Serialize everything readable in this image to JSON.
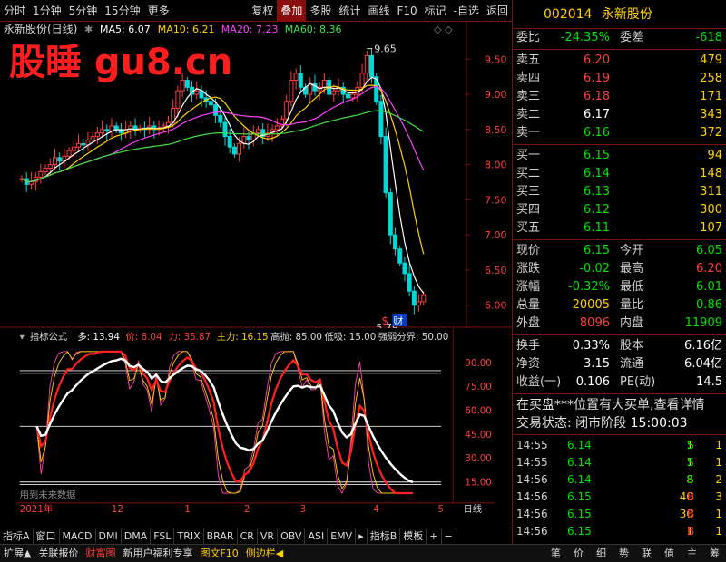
{
  "watermark": "股睡 gu8.cn",
  "toolbar": {
    "left": [
      "分时",
      "1分钟",
      "5分钟",
      "15分钟",
      "更多"
    ],
    "right": [
      "复权",
      "叠加",
      "多股",
      "统计",
      "画线",
      "F10",
      "标记",
      "-自选",
      "返回"
    ],
    "active": "叠加"
  },
  "chart": {
    "title": "永新股份(日线)",
    "ma": [
      {
        "label": "MA5: 6.07",
        "color": "#ffffff"
      },
      {
        "label": "MA10: 6.21",
        "color": "#ffd000"
      },
      {
        "label": "MA20: 7.23",
        "color": "#ff40ff"
      },
      {
        "label": "MA60: 8.36",
        "color": "#40e040"
      }
    ],
    "price_axis": [
      "9.50",
      "9.00",
      "8.50",
      "8.00",
      "7.50",
      "7.00",
      "6.50",
      "6.00"
    ],
    "high_label": "9.65",
    "low_label": "5.79",
    "badge_dollar": "$",
    "badge_cai": "财"
  },
  "indicator": {
    "name": "指标公式",
    "values": [
      {
        "label": "多: 13.94",
        "color": "#ffffff"
      },
      {
        "label": "价: 8.04",
        "color": "#ff3c3c"
      },
      {
        "label": "力: 35.87",
        "color": "#ff3c3c"
      },
      {
        "label": "主力: 16.15",
        "color": "#ffd000"
      },
      {
        "label": "高抛: 85.00",
        "color": "#dddddd"
      },
      {
        "label": "低吸: 15.00",
        "color": "#dddddd"
      },
      {
        "label": "强弱分界: 50.00",
        "color": "#dddddd"
      }
    ],
    "axis": [
      "90.00",
      "75.00",
      "60.00",
      "45.00",
      "30.00",
      "15.00"
    ],
    "note": "用到未来数据"
  },
  "date_axis": {
    "labels": [
      "2021年",
      "12",
      "1",
      "2",
      "3",
      "4",
      "5"
    ],
    "period": "日线"
  },
  "bottom_tabs": [
    "指标A",
    "窗口",
    "MACD",
    "DMI",
    "DMA",
    "FSL",
    "TRIX",
    "BRAR",
    "CR",
    "VR",
    "OBV",
    "ASI",
    "EMV",
    "▸",
    "指标B",
    "模板",
    "+",
    "−"
  ],
  "status": [
    "扩展▲",
    "关联报价",
    "财富图",
    "新用户福利专享",
    "图文F10",
    "侧边栏◀"
  ],
  "status_icons": [
    "笔",
    "价",
    "细",
    "势",
    "联",
    "值",
    "主",
    "筹"
  ],
  "quote": {
    "code": "002014",
    "name": "永新股份",
    "weibi": {
      "label": "委比",
      "value": "-24.35%",
      "label2": "委差",
      "value2": "-618"
    },
    "sells": [
      {
        "label": "卖五",
        "price": "6.20",
        "vol": "479"
      },
      {
        "label": "卖四",
        "price": "6.19",
        "vol": "258"
      },
      {
        "label": "卖三",
        "price": "6.18",
        "vol": "171"
      },
      {
        "label": "卖二",
        "price": "6.17",
        "vol": "343"
      },
      {
        "label": "卖一",
        "price": "6.16",
        "vol": "372"
      }
    ],
    "buys": [
      {
        "label": "买一",
        "price": "6.15",
        "vol": "94"
      },
      {
        "label": "买二",
        "price": "6.14",
        "vol": "148"
      },
      {
        "label": "买三",
        "price": "6.13",
        "vol": "311"
      },
      {
        "label": "买四",
        "price": "6.12",
        "vol": "300"
      },
      {
        "label": "买五",
        "price": "6.11",
        "vol": "107"
      }
    ],
    "stats": [
      {
        "l": "现价",
        "v": "6.15",
        "vc": "dn",
        "l2": "今开",
        "v2": "6.05",
        "v2c": "dn"
      },
      {
        "l": "涨跌",
        "v": "-0.02",
        "vc": "dn",
        "l2": "最高",
        "v2": "6.20",
        "v2c": "up"
      },
      {
        "l": "涨幅",
        "v": "-0.32%",
        "vc": "dn",
        "l2": "最低",
        "v2": "6.01",
        "v2c": "dn"
      },
      {
        "l": "总量",
        "v": "20005",
        "vc": "yl",
        "l2": "量比",
        "v2": "0.86",
        "v2c": "dn"
      },
      {
        "l": "外盘",
        "v": "8096",
        "vc": "up",
        "l2": "内盘",
        "v2": "11909",
        "v2c": "dn"
      }
    ],
    "stats2": [
      {
        "l": "换手",
        "v": "0.33%",
        "vc": "wh",
        "l2": "股本",
        "v2": "6.16亿",
        "v2c": "wh"
      },
      {
        "l": "净资",
        "v": "3.15",
        "vc": "wh",
        "l2": "流通",
        "v2": "6.04亿",
        "v2c": "wh"
      },
      {
        "l": "收益(一)",
        "v": "0.106",
        "vc": "wh",
        "l2": "PE(动)",
        "v2": "14.5",
        "v2c": "wh"
      }
    ],
    "info1": "在买盘***位置有大买单,查看详情",
    "info2_label": "交易状态: 闭市阶段",
    "info2_time": "15:00:03",
    "ticks": [
      {
        "t": "14:55",
        "p": "6.14",
        "v": "1",
        "bs": "S",
        "n": "1"
      },
      {
        "t": "14:55",
        "p": "6.14",
        "v": "1",
        "bs": "S",
        "n": "1"
      },
      {
        "t": "14:56",
        "p": "6.14",
        "v": "8",
        "bs": "S",
        "n": "2"
      },
      {
        "t": "14:56",
        "p": "6.15",
        "v": "40",
        "bs": "B",
        "n": "3"
      },
      {
        "t": "14:56",
        "p": "6.15",
        "v": "30",
        "bs": "B",
        "n": "1"
      },
      {
        "t": "14:56",
        "p": "6.15",
        "v": "1",
        "bs": "B",
        "n": "1"
      },
      {
        "t": "14:57",
        "p": "6.14",
        "v": "1",
        "bs": "S",
        "n": "1"
      },
      {
        "t": "15:00",
        "p": "6.15",
        "v": "460",
        "bs": "",
        "n": "26"
      }
    ]
  },
  "chart_data": {
    "type": "candlestick",
    "ylim": [
      5.7,
      9.8
    ],
    "closes": [
      7.8,
      7.72,
      7.76,
      7.82,
      7.9,
      7.95,
      8.0,
      8.1,
      8.05,
      8.12,
      8.2,
      8.25,
      8.3,
      8.28,
      8.35,
      8.4,
      8.45,
      8.5,
      8.48,
      8.55,
      8.5,
      8.45,
      8.5,
      8.55,
      8.5,
      8.52,
      8.5,
      8.55,
      8.5,
      8.52,
      8.55,
      8.6,
      8.8,
      9.05,
      9.2,
      9.1,
      9.0,
      9.05,
      8.95,
      8.9,
      8.85,
      8.7,
      8.6,
      8.4,
      8.25,
      8.15,
      8.3,
      8.4,
      8.35,
      8.45,
      8.5,
      8.4,
      8.45,
      8.5,
      8.55,
      8.65,
      8.9,
      9.2,
      9.3,
      9.1,
      9.0,
      9.15,
      9.05,
      9.1,
      9.2,
      9.0,
      9.05,
      9.1,
      9.0,
      8.95,
      9.0,
      9.1,
      9.3,
      9.55,
      9.25,
      8.9,
      8.4,
      7.6,
      7.0,
      6.8,
      6.6,
      6.45,
      6.2,
      6.0,
      6.05,
      6.15
    ],
    "indicator_ylim": [
      5,
      100
    ],
    "lines_levels": [
      85,
      15,
      50
    ]
  }
}
